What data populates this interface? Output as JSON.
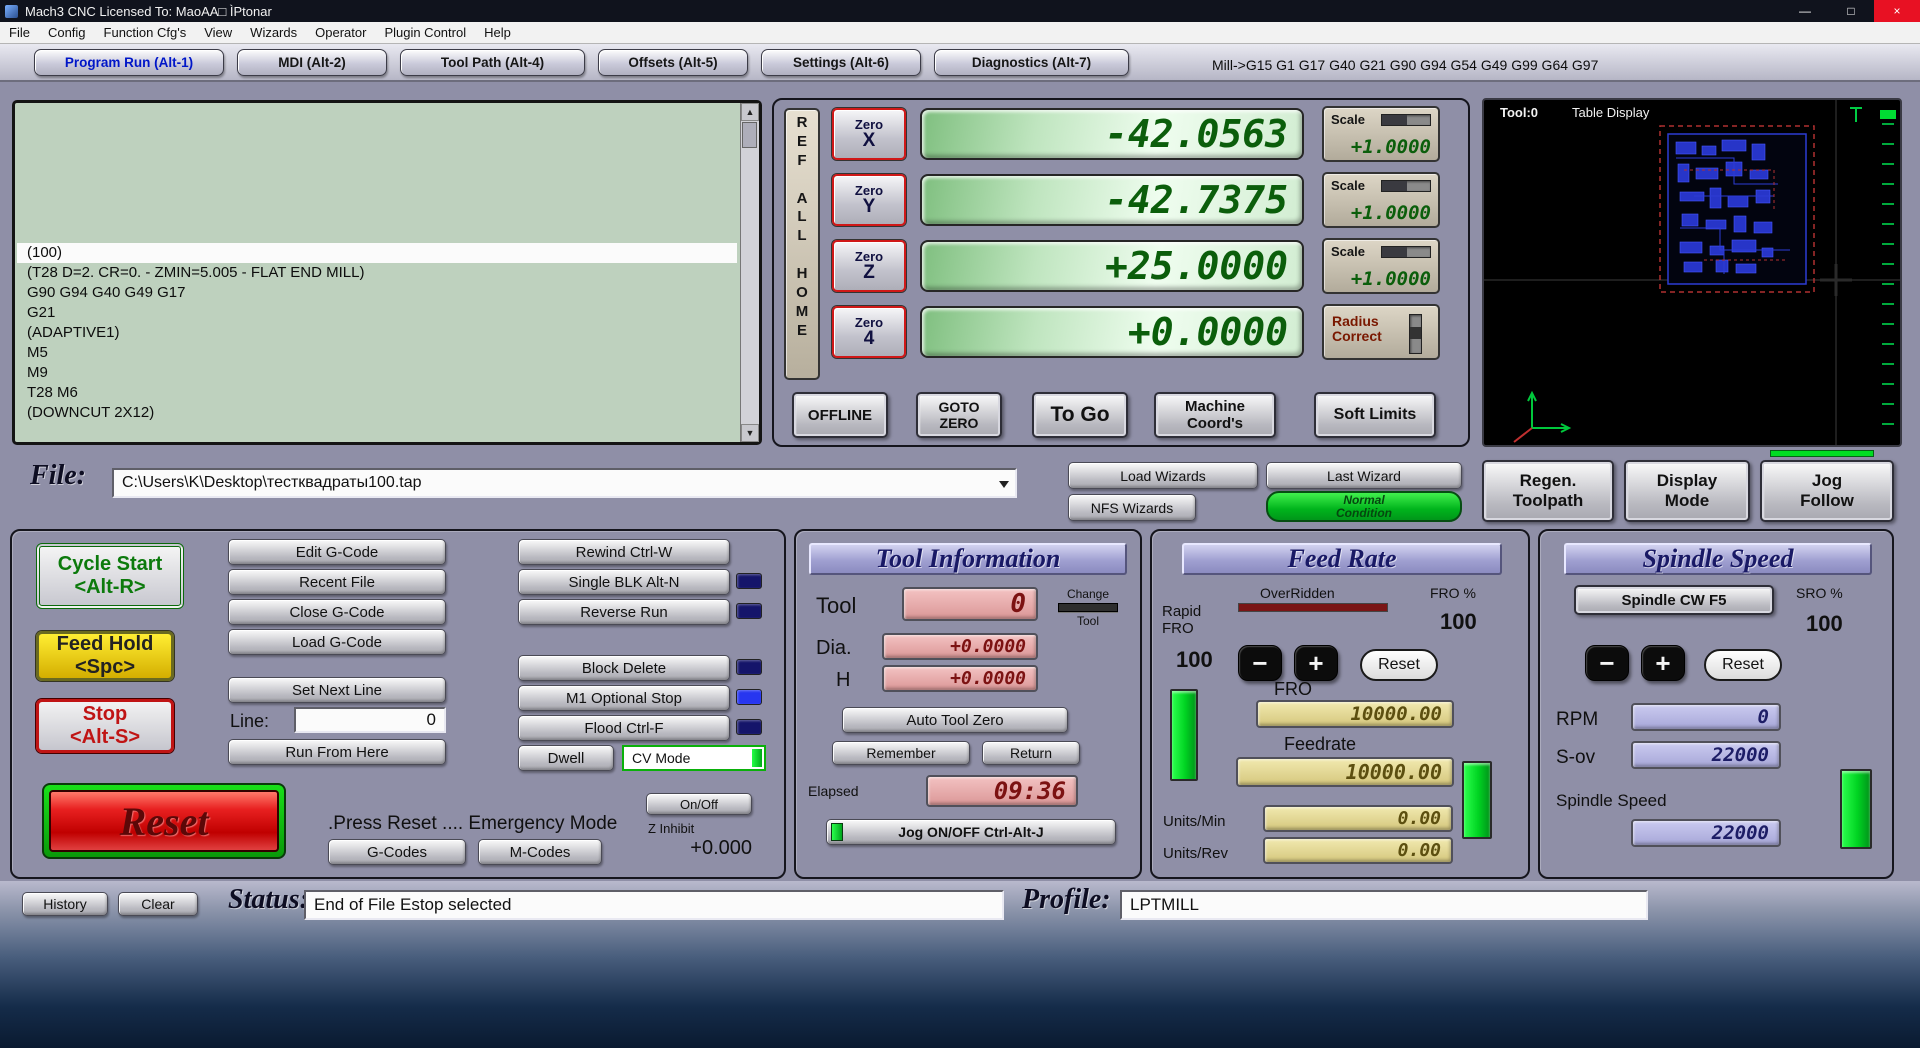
{
  "colors": {
    "led_on_blue": "#2736f0",
    "led_on_green": "#00dd22",
    "accent_green": "#00c000",
    "dro_digits": "#0b5e0b",
    "alarm_red": "#c01414"
  },
  "window": {
    "title": "Mach3 CNC  Licensed To: MaoAA□ ÌPtonar",
    "minimize": "—",
    "maximize": "□",
    "close": "×"
  },
  "menubar": {
    "items": [
      "File",
      "Config",
      "Function Cfg's",
      "View",
      "Wizards",
      "Operator",
      "Plugin Control",
      "Help"
    ]
  },
  "tabs": {
    "items": [
      "Program Run (Alt-1)",
      "MDI (Alt-2)",
      "Tool Path (Alt-4)",
      "Offsets (Alt-5)",
      "Settings (Alt-6)",
      "Diagnostics (Alt-7)"
    ],
    "modes": "Mill->G15  G1 G17 G40 G21 G90 G94 G54 G49 G99 G64 G97"
  },
  "gcode": {
    "lines": [
      "(100)",
      "(T28  D=2. CR=0. - ZMIN=5.005 - FLAT END MILL)",
      "G90 G94 G40 G49 G17",
      "G21",
      "(ADAPTIVE1)",
      "M5",
      "M9",
      "T28 M6",
      "(DOWNCUT 2X12)"
    ],
    "scroll_up": "▲",
    "scroll_down": "▼"
  },
  "dro": {
    "ref_all_home": "R\nE\nF\n\nA\nL\nL\n\nH\nO\nM\nE",
    "axes": [
      {
        "zero": "Zero",
        "axis": "X",
        "value": "-42.0563"
      },
      {
        "zero": "Zero",
        "axis": "Y",
        "value": "-42.7375"
      },
      {
        "zero": "Zero",
        "axis": "Z",
        "value": "+25.0000"
      },
      {
        "zero": "Zero",
        "axis": "4",
        "value": "+0.0000"
      }
    ],
    "scales": [
      {
        "label": "Scale",
        "value": "+1.0000"
      },
      {
        "label": "Scale",
        "value": "+1.0000"
      },
      {
        "label": "Scale",
        "value": "+1.0000"
      }
    ],
    "radius_correct": "Radius\nCorrect",
    "offline": "OFFLINE",
    "goto_zero": "GOTO\nZERO",
    "to_go": "To Go",
    "machine_coords": "Machine\nCoord's",
    "soft_limits": "Soft Limits"
  },
  "toolpath": {
    "tool": "Tool:0",
    "display": "Table Display"
  },
  "file_row": {
    "label": "File:",
    "path": "C:\\Users\\K\\Desktop\\тестквадраты100.tap",
    "load_wizards": "Load Wizards",
    "last_wizard": "Last Wizard",
    "nfs_wizards": "NFS Wizards",
    "normal_condition": "Normal\nCondition",
    "regen_toolpath": "Regen.\nToolpath",
    "display_mode": "Display\nMode",
    "jog_follow": "Jog\nFollow"
  },
  "program": {
    "cycle_start": "Cycle Start\n<Alt-R>",
    "feed_hold": "Feed Hold\n<Spc>",
    "stop": "Stop\n<Alt-S>",
    "reset": "Reset",
    "edit_gcode": "Edit G-Code",
    "recent_file": "Recent File",
    "close_gcode": "Close G-Code",
    "load_gcode": "Load G-Code",
    "set_next_line": "Set Next Line",
    "line_label": "Line:",
    "line_value": "0",
    "run_from_here": "Run From Here",
    "rewind": "Rewind Ctrl-W",
    "single_blk": "Single BLK Alt-N",
    "reverse_run": "Reverse Run",
    "block_delete": "Block Delete",
    "m1_optional_stop": "M1 Optional Stop",
    "flood": "Flood Ctrl-F",
    "dwell": "Dwell",
    "cv_mode": "CV Mode",
    "emergency": ".Press Reset .... Emergency Mode",
    "on_off": "On/Off",
    "z_inhibit": "Z Inhibit",
    "z_inhibit_value": "+0.000",
    "g_codes": "G-Codes",
    "m_codes": "M-Codes"
  },
  "tool_info": {
    "title": "Tool Information",
    "tool_label": "Tool",
    "tool_value": "0",
    "change_top": "Change",
    "change_bottom": "Tool",
    "dia_label": "Dia.",
    "dia_value": "+0.0000",
    "h_label": "H",
    "h_value": "+0.0000",
    "auto_tool_zero": "Auto Tool Zero",
    "remember": "Remember",
    "return": "Return",
    "elapsed_label": "Elapsed",
    "elapsed_value": "09:36",
    "jog_onoff": "Jog ON/OFF Ctrl-Alt-J"
  },
  "feed_rate": {
    "title": "Feed Rate",
    "overridden": "OverRidden",
    "fro_pct_label": "FRO %",
    "fro_pct_value": "100",
    "rapid_label": "Rapid\nFRO",
    "rapid_value": "100",
    "minus": "−",
    "plus": "+",
    "reset": "Reset",
    "fro_label": "FRO",
    "fro_value": "10000.00",
    "feedrate_label": "Feedrate",
    "feedrate_value": "10000.00",
    "units_min_label": "Units/Min",
    "units_min_value": "0.00",
    "units_rev_label": "Units/Rev",
    "units_rev_value": "0.00"
  },
  "spindle": {
    "title": "Spindle Speed",
    "cw_button": "Spindle CW F5",
    "sro_pct_label": "SRO %",
    "sro_pct_value": "100",
    "minus": "−",
    "plus": "+",
    "reset": "Reset",
    "rpm_label": "RPM",
    "rpm_value": "0",
    "sov_label": "S-ov",
    "sov_value": "22000",
    "speed_label": "Spindle Speed",
    "speed_value": "22000"
  },
  "status_bar": {
    "history": "History",
    "clear": "Clear",
    "status_label": "Status:",
    "status_value": "End of File Estop selected",
    "profile_label": "Profile:",
    "profile_value": "LPTMILL"
  }
}
